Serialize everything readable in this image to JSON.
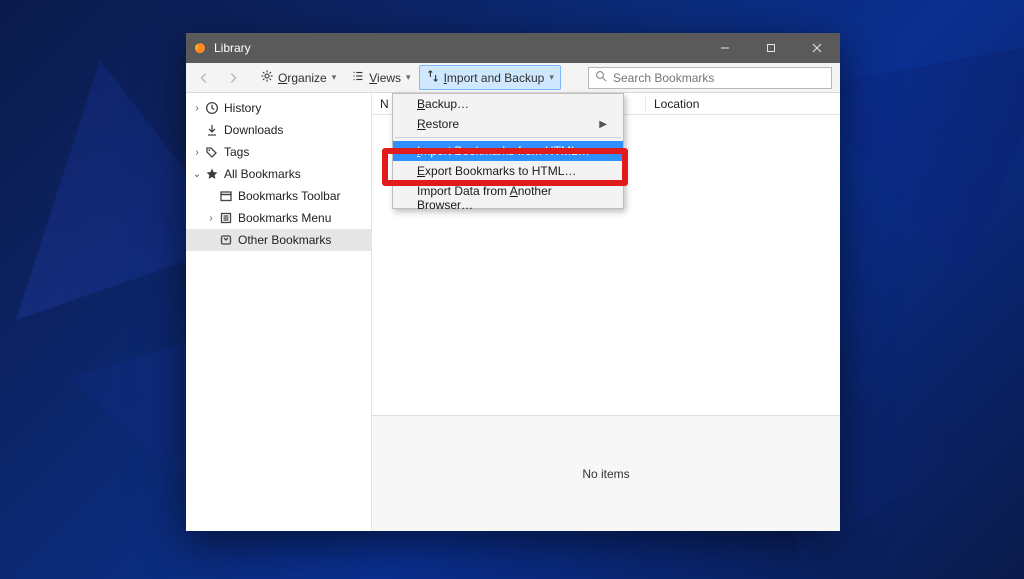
{
  "titlebar": {
    "title": "Library"
  },
  "toolbar": {
    "organize": "rganize",
    "views": "iews",
    "importbackup": "mport and Backup"
  },
  "search": {
    "placeholder": "Search Bookmarks"
  },
  "sidebar": {
    "history": "History",
    "downloads": "Downloads",
    "tags": "Tags",
    "allbookmarks": "All Bookmarks",
    "toolbar": "Bookmarks Toolbar",
    "menu": "Bookmarks Menu",
    "other": "Other Bookmarks"
  },
  "columns": {
    "name": "N",
    "location": "Location"
  },
  "detail": {
    "empty": "No items"
  },
  "menu": {
    "backup": "ackup…",
    "restore": "estore",
    "importhtml": "mport Bookmarks from HTML…",
    "exporthtml": "xport Bookmarks to HTML…",
    "importbrowser_pre": "Import Data from ",
    "importbrowser_post": "nother Browser…"
  }
}
